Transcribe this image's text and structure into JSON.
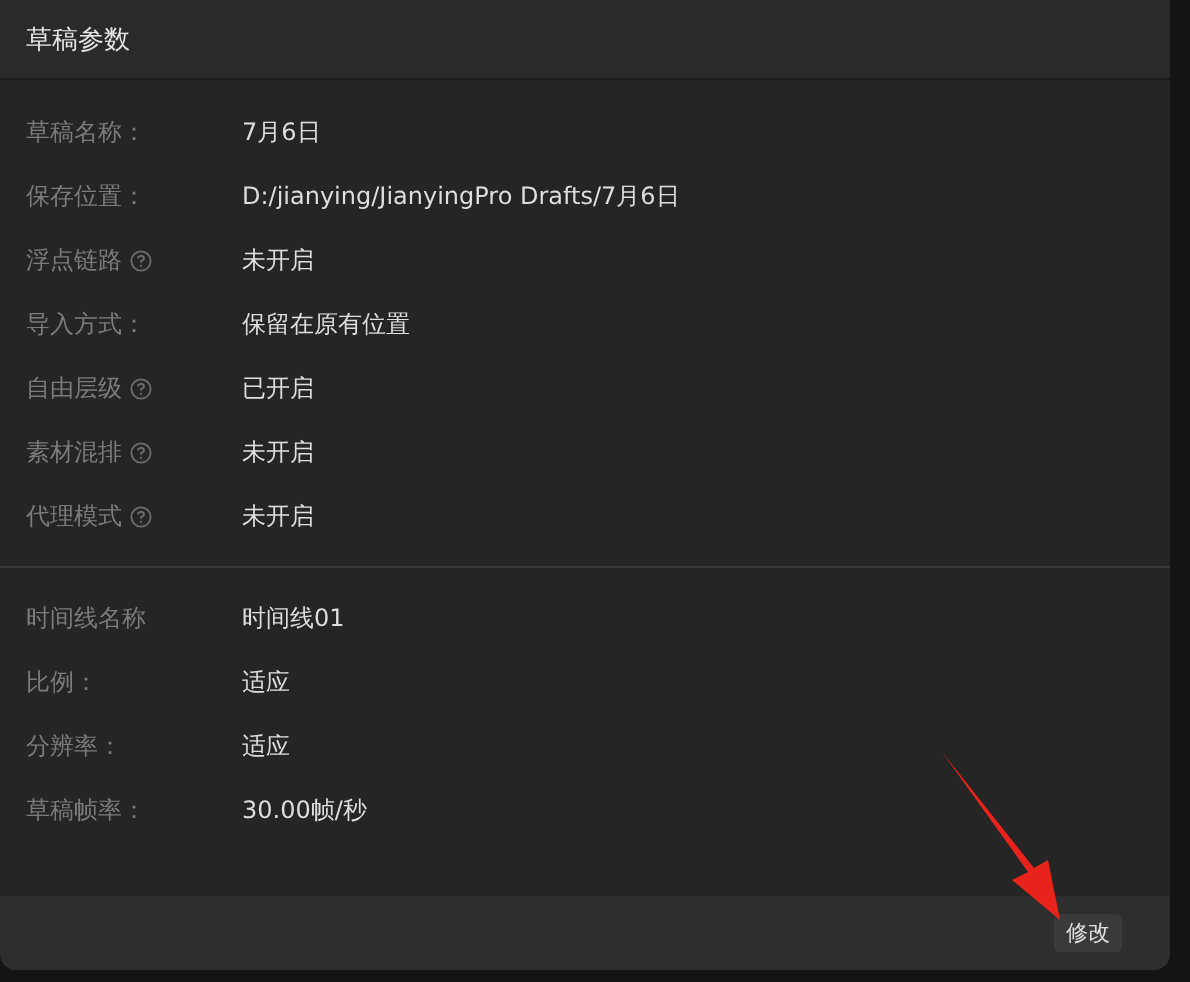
{
  "dialog": {
    "title": "草稿参数"
  },
  "sections": [
    {
      "rows": [
        {
          "label": "草稿名称：",
          "help": false,
          "value": "7月6日"
        },
        {
          "label": "保存位置：",
          "help": false,
          "value": "D:/jianying/JianyingPro Drafts/7月6日"
        },
        {
          "label": "浮点链路",
          "help": true,
          "value": "未开启"
        },
        {
          "label": "导入方式：",
          "help": false,
          "value": "保留在原有位置"
        },
        {
          "label": "自由层级",
          "help": true,
          "value": "已开启"
        },
        {
          "label": "素材混排",
          "help": true,
          "value": "未开启"
        },
        {
          "label": "代理模式",
          "help": true,
          "value": "未开启"
        }
      ]
    },
    {
      "rows": [
        {
          "label": "时间线名称",
          "help": false,
          "value": "时间线01"
        },
        {
          "label": "比例：",
          "help": false,
          "value": "适应"
        },
        {
          "label": "分辨率：",
          "help": false,
          "value": "适应"
        },
        {
          "label": "草稿帧率：",
          "help": false,
          "value": "30.00帧/秒"
        }
      ]
    }
  ],
  "footer": {
    "button": "修改"
  }
}
